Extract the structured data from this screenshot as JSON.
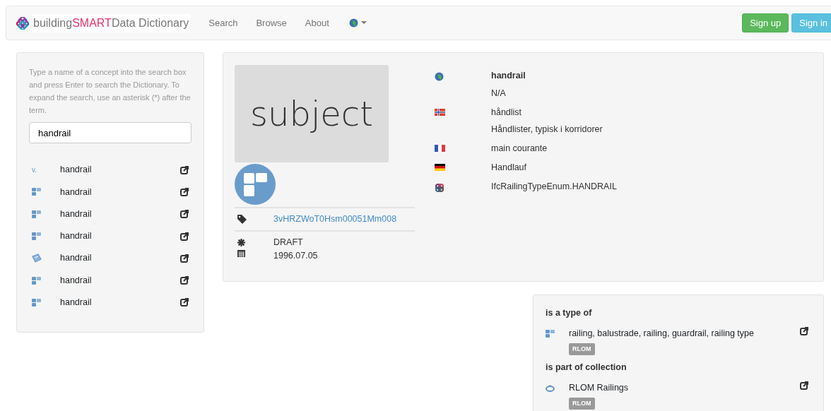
{
  "navbar": {
    "brand": [
      "building",
      "SMART",
      "Data Dictionary"
    ],
    "links": [
      "Search",
      "Browse",
      "About"
    ],
    "buttons": [
      {
        "label": "Sign up",
        "kind": "success"
      },
      {
        "label": "Sign in",
        "kind": "info"
      }
    ]
  },
  "search_panel": {
    "help": "Type a name of a concept into the search box and press Enter to search the Dictionary. To expand the search, use an asterisk (*) after the term.",
    "value": "handrail",
    "results": [
      {
        "kind": "vocabulary",
        "mark": "v.",
        "label": "handrail"
      },
      {
        "kind": "subject",
        "label": "handrail"
      },
      {
        "kind": "subject",
        "label": "handrail"
      },
      {
        "kind": "subject",
        "label": "handrail"
      },
      {
        "kind": "document",
        "label": "handrail"
      },
      {
        "kind": "subject",
        "label": "handrail"
      },
      {
        "kind": "subject",
        "label": "handrail"
      }
    ]
  },
  "concept": {
    "type_label": "subject",
    "guid": "3vHRZWoT0Hsm00051Mm008",
    "status": "DRAFT",
    "date": "1996.07.05",
    "names": [
      {
        "kind": "intl",
        "name": "handrail",
        "description": "N/A"
      },
      {
        "kind": "no",
        "name": "håndlist",
        "description": "Håndlister, typisk i korridorer"
      },
      {
        "kind": "fr",
        "name": "main courante"
      },
      {
        "kind": "de",
        "name": "Handlauf"
      },
      {
        "kind": "ifc",
        "name": "IfcRailingTypeEnum.HANDRAIL"
      }
    ]
  },
  "relations": [
    {
      "heading": "is a type of",
      "items": [
        {
          "kind": "subject",
          "label": "railing, balustrade, railing, guardrail, railing type",
          "tag": "RLOM"
        }
      ]
    },
    {
      "heading": "is part of collection",
      "items": [
        {
          "kind": "collection",
          "label": "RLOM Railings",
          "tag": "RLOM"
        }
      ]
    }
  ]
}
